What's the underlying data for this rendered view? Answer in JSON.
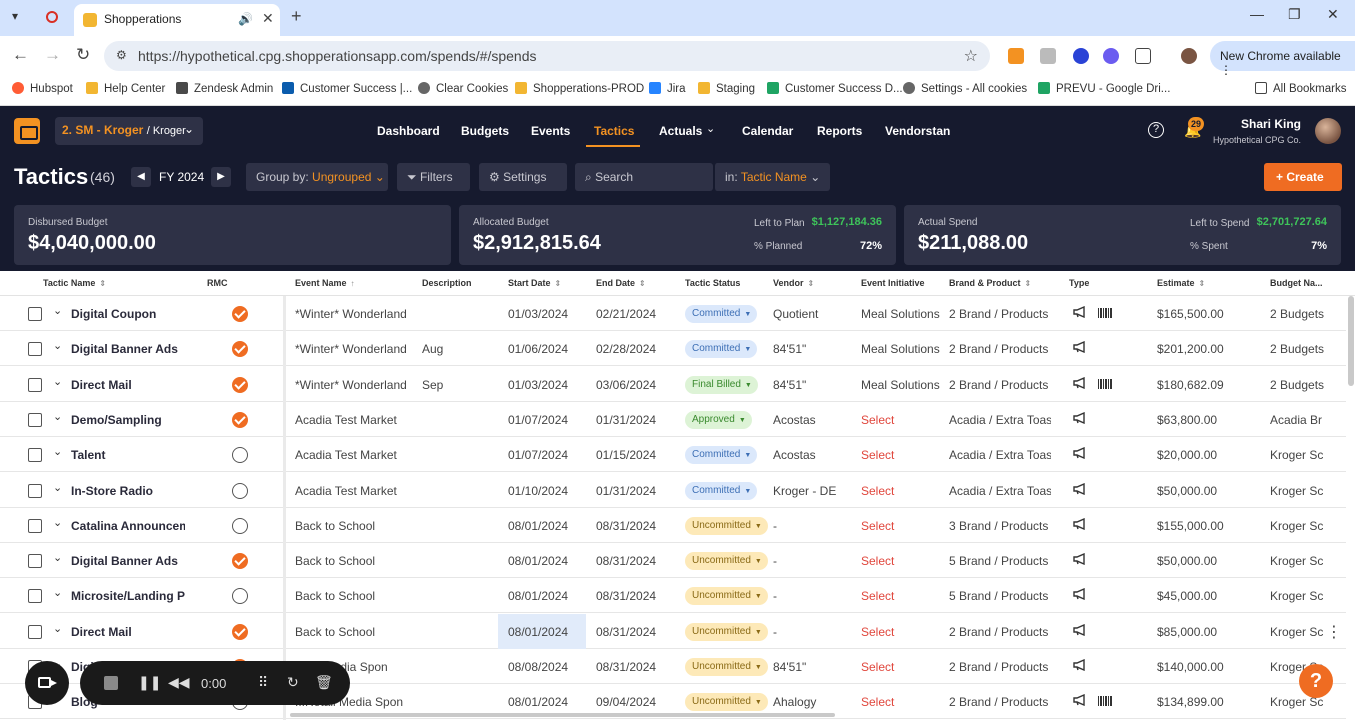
{
  "browser": {
    "tab_title": "Shopperations",
    "url": "https://hypothetical.cpg.shopperationsapp.com/spends/#/spends",
    "new_chrome": "New Chrome available",
    "bookmarks": [
      {
        "label": "Hubspot",
        "color": "#ff5c35"
      },
      {
        "label": "Help Center",
        "color": "#f2b632"
      },
      {
        "label": "Zendesk Admin",
        "color": "#4a4a4a"
      },
      {
        "label": "Customer Success |...",
        "color": "#0b5cad"
      },
      {
        "label": "Clear Cookies",
        "color": "#666666"
      },
      {
        "label": "Shopperations-PROD",
        "color": "#f2b632"
      },
      {
        "label": "Jira",
        "color": "#2684ff"
      },
      {
        "label": "Staging",
        "color": "#f2b632"
      },
      {
        "label": "Customer Success D...",
        "color": "#1fa463"
      },
      {
        "label": "Settings - All cookies",
        "color": "#666666"
      },
      {
        "label": "PREVU - Google Dri...",
        "color": "#1fa463"
      }
    ],
    "all_bookmarks": "All Bookmarks"
  },
  "nav": {
    "account_code": "2. SM - Kroger",
    "account_sub": "/ Kroger",
    "links": [
      "Dashboard",
      "Budgets",
      "Events",
      "Tactics",
      "Actuals",
      "Calendar",
      "Reports",
      "Vendorstan"
    ],
    "active": "Tactics",
    "notifications": "29",
    "user_name": "Shari King",
    "user_company": "Hypothetical CPG Co."
  },
  "toolbar": {
    "title": "Tactics",
    "count": "(46)",
    "fiscal_year": "FY 2024",
    "group_by_label": "Group by:",
    "group_by_value": "Ungrouped",
    "filters": "Filters",
    "settings": "Settings",
    "search_placeholder": "Search",
    "in_label": "in:",
    "in_value": "Tactic Name",
    "create": "Create"
  },
  "summary": {
    "disbursed_label": "Disbursed Budget",
    "disbursed_value": "$4,040,000.00",
    "allocated_label": "Allocated Budget",
    "allocated_value": "$2,912,815.64",
    "left_to_plan_label": "Left to Plan",
    "left_to_plan_value": "$1,127,184.36",
    "planned_label": "% Planned",
    "planned_value": "72%",
    "actual_label": "Actual Spend",
    "actual_value": "$211,088.00",
    "left_to_spend_label": "Left to Spend",
    "left_to_spend_value": "$2,701,727.64",
    "spent_label": "% Spent",
    "spent_value": "7%"
  },
  "table": {
    "headers": {
      "tactic_name": "Tactic Name",
      "rmc": "RMC",
      "event_name": "Event Name",
      "description": "Description",
      "start_date": "Start Date",
      "end_date": "End Date",
      "tactic_status": "Tactic Status",
      "vendor": "Vendor",
      "event_initiative": "Event Initiative",
      "brand_product": "Brand & Product",
      "type": "Type",
      "estimate": "Estimate",
      "budget_name": "Budget Na..."
    },
    "rows": [
      {
        "name": "Digital Coupon",
        "rmc": true,
        "event": "*Winter* Wonderland",
        "desc": "",
        "start": "01/03/2024",
        "end": "02/21/2024",
        "status": "Committed",
        "vendor": "Quotient",
        "initiative": "Meal Solutions",
        "brand": "2 Brand / Products",
        "barcode": true,
        "estimate": "$165,500.00",
        "budget": "2 Budgets"
      },
      {
        "name": "Digital Banner Ads",
        "rmc": true,
        "event": "*Winter* Wonderland",
        "desc": "Aug",
        "start": "01/06/2024",
        "end": "02/28/2024",
        "status": "Committed",
        "vendor": "84'51\"",
        "initiative": "Meal Solutions",
        "brand": "2 Brand / Products",
        "barcode": false,
        "estimate": "$201,200.00",
        "budget": "2 Budgets"
      },
      {
        "name": "Direct Mail",
        "rmc": true,
        "event": "*Winter* Wonderland",
        "desc": "Sep",
        "start": "01/03/2024",
        "end": "03/06/2024",
        "status": "Final Billed",
        "vendor": "84'51\"",
        "initiative": "Meal Solutions",
        "brand": "2 Brand / Products",
        "barcode": true,
        "estimate": "$180,682.09",
        "budget": "2 Budgets"
      },
      {
        "name": "Demo/Sampling",
        "rmc": true,
        "event": "Acadia Test Market",
        "desc": "",
        "start": "01/07/2024",
        "end": "01/31/2024",
        "status": "Approved",
        "vendor": "Acostas",
        "initiative": "Select",
        "brand": "Acadia / Extra Toas",
        "barcode": false,
        "estimate": "$63,800.00",
        "budget": "Acadia Br"
      },
      {
        "name": "Talent",
        "rmc": false,
        "event": "Acadia Test Market",
        "desc": "",
        "start": "01/07/2024",
        "end": "01/15/2024",
        "status": "Committed",
        "vendor": "Acostas",
        "initiative": "Select",
        "brand": "Acadia / Extra Toas",
        "barcode": false,
        "estimate": "$20,000.00",
        "budget": "Kroger Sc"
      },
      {
        "name": "In-Store Radio",
        "rmc": false,
        "event": "Acadia Test Market",
        "desc": "",
        "start": "01/10/2024",
        "end": "01/31/2024",
        "status": "Committed",
        "vendor": "Kroger - DE",
        "initiative": "Select",
        "brand": "Acadia / Extra Toas",
        "barcode": false,
        "estimate": "$50,000.00",
        "budget": "Kroger Sc"
      },
      {
        "name": "Catalina Announceme",
        "rmc": false,
        "event": "Back to School",
        "desc": "",
        "start": "08/01/2024",
        "end": "08/31/2024",
        "status": "Uncommitted",
        "vendor": "-",
        "initiative": "Select",
        "brand": "3 Brand / Products",
        "barcode": false,
        "estimate": "$155,000.00",
        "budget": "Kroger Sc"
      },
      {
        "name": "Digital Banner Ads",
        "rmc": true,
        "event": "Back to School",
        "desc": "",
        "start": "08/01/2024",
        "end": "08/31/2024",
        "status": "Uncommitted",
        "vendor": "-",
        "initiative": "Select",
        "brand": "5 Brand / Products",
        "barcode": false,
        "estimate": "$50,000.00",
        "budget": "Kroger Sc"
      },
      {
        "name": "Microsite/Landing Pa",
        "rmc": false,
        "event": "Back to School",
        "desc": "",
        "start": "08/01/2024",
        "end": "08/31/2024",
        "status": "Uncommitted",
        "vendor": "-",
        "initiative": "Select",
        "brand": "5 Brand / Products",
        "barcode": false,
        "estimate": "$45,000.00",
        "budget": "Kroger Sc"
      },
      {
        "name": "Direct Mail",
        "rmc": true,
        "event": "Back to School",
        "desc": "",
        "start": "08/01/2024",
        "end": "08/31/2024",
        "status": "Uncommitted",
        "vendor": "-",
        "initiative": "Select",
        "brand": "2 Brand / Products",
        "barcode": false,
        "estimate": "$85,000.00",
        "budget": "Kroger Sc"
      },
      {
        "name": "Digi",
        "rmc": true,
        "event": "...tail Media Spon",
        "desc": "",
        "start": "08/08/2024",
        "end": "08/31/2024",
        "status": "Uncommitted",
        "vendor": "84'51\"",
        "initiative": "Select",
        "brand": "2 Brand / Products",
        "barcode": false,
        "estimate": "$140,000.00",
        "budget": "Kroger Sc"
      },
      {
        "name": "Blog",
        "rmc": false,
        "event": "...Retail Media Spon",
        "desc": "",
        "start": "08/01/2024",
        "end": "09/04/2024",
        "status": "Uncommitted",
        "vendor": "Ahalogy",
        "initiative": "Select",
        "brand": "2 Brand / Products",
        "barcode": true,
        "estimate": "$134,899.00",
        "budget": "Kroger Sc"
      }
    ]
  },
  "recorder": {
    "time": "0:00"
  }
}
